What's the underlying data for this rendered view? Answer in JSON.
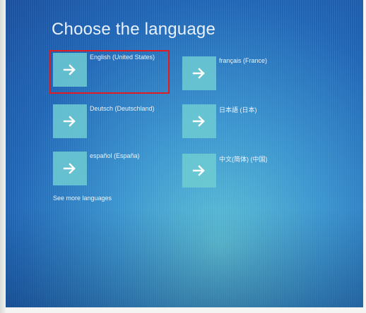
{
  "title": "Choose the language",
  "languages": [
    {
      "label": "English (United States)",
      "selected": true
    },
    {
      "label": "français (France)",
      "selected": false
    },
    {
      "label": "Deutsch (Deutschland)",
      "selected": false
    },
    {
      "label": "日本語 (日本)",
      "selected": false
    },
    {
      "label": "español (España)",
      "selected": false
    },
    {
      "label": "中文(简体) (中国)",
      "selected": false
    }
  ],
  "more_link": "See more languages",
  "colors": {
    "tile": "#6ecdd2",
    "highlight": "#e21b22",
    "text": "#eef6ff"
  },
  "icons": {
    "tile_icon": "arrow-right-icon"
  }
}
